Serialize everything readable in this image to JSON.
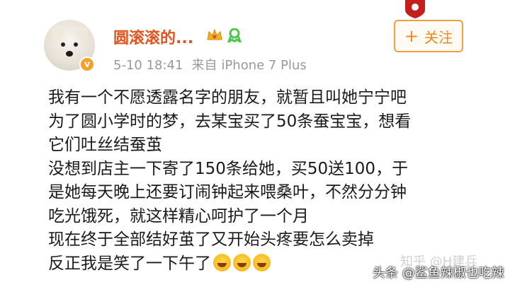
{
  "post": {
    "username": "圆滚滚的...",
    "date": "5-10 18:41",
    "source_prefix": "来自",
    "source": "iPhone 7 Plus",
    "verified_badge": "v",
    "follow_label": "关注",
    "follow_icon": "plus-icon",
    "content_lines": [
      "我有一个不愿透露名字的朋友，就暂且叫她宁宁吧",
      "为了圆小学时的梦，去某宝买了50条蚕宝宝，想看",
      "它们吐丝结蚕茧",
      "没想到店主一下寄了150条给她，买50送100，于",
      "是她每天晚上还要订闹钟起来喂桑叶，不然分分钟",
      "吃光饿死，就这样精心呵护了一个月",
      "现在终于全部结好茧了又开始头疼要怎么卖掉",
      "反正我是笑了一下午了"
    ],
    "emojis": [
      "laughing-crying-emoji",
      "laughing-crying-emoji",
      "laughing-crying-emoji"
    ]
  },
  "watermarks": {
    "zhihu": "知乎 @H建兵",
    "toutiao": "头条 @鲨鱼辣椒也吃辣"
  },
  "colors": {
    "username": "#e0551e",
    "meta": "#999999",
    "follow_border": "#f0a040",
    "follow_text": "#e8891e"
  }
}
